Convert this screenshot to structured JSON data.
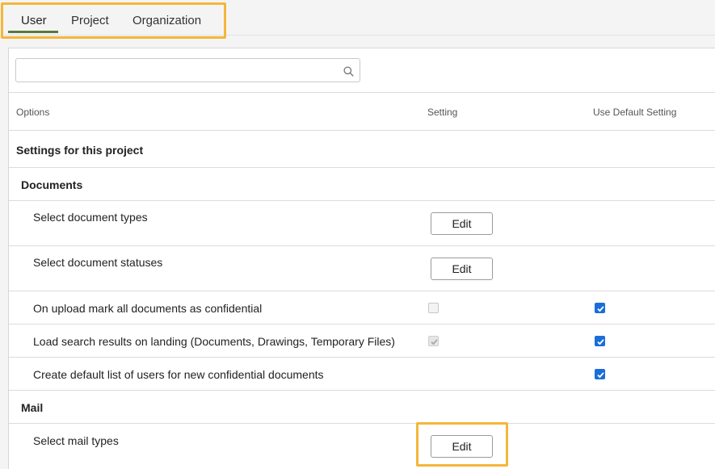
{
  "tabs": [
    {
      "label": "User"
    },
    {
      "label": "Project"
    },
    {
      "label": "Organization"
    }
  ],
  "search": {
    "placeholder": ""
  },
  "columns": {
    "options": "Options",
    "setting": "Setting",
    "default": "Use Default Setting"
  },
  "sections": {
    "project": "Settings for this project",
    "documents": "Documents",
    "mail": "Mail"
  },
  "rows": {
    "doc_types": {
      "label": "Select document types",
      "button": "Edit"
    },
    "doc_statuses": {
      "label": "Select document statuses",
      "button": "Edit"
    },
    "confidential": {
      "label": "On upload mark all documents as confidential",
      "setting_checked": false,
      "default_checked": true
    },
    "load_search": {
      "label": "Load search results on landing (Documents, Drawings, Temporary Files)",
      "setting_checked": true,
      "default_checked": true
    },
    "default_users": {
      "label": "Create default list of users for new confidential documents",
      "default_checked": true
    },
    "mail_types": {
      "label": "Select mail types",
      "button": "Edit"
    }
  },
  "colors": {
    "accent": "#5a7a3a",
    "highlight": "#f4b63a",
    "checkbox": "#1a6ed8"
  }
}
